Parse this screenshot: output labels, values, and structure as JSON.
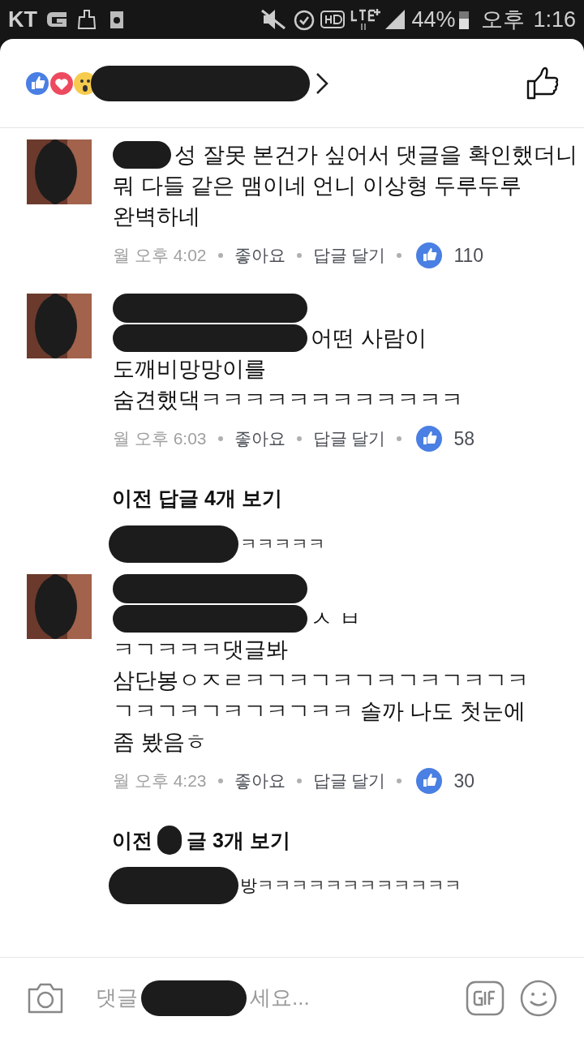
{
  "status_bar": {
    "carrier": "KT",
    "battery": "44%",
    "period": "오후",
    "time": "1:16"
  },
  "feed": [
    {
      "kind": "comment",
      "name_redacted": false,
      "lines": [
        {
          "text": "성 잘못 본건가 싶어서 댓글을 확인했더니",
          "redacted": true
        },
        {
          "text": "뭐 다들 같은 맴이네 언니 이상형 두루두루",
          "redacted": false
        },
        {
          "text": "완벽하네",
          "redacted": false
        }
      ],
      "time": "월 오후 4:02",
      "like_label": "좋아요",
      "reply_label": "답글 달기",
      "like_count": "110"
    },
    {
      "kind": "comment",
      "name_redacted": true,
      "lines": [
        {
          "text": "어떤 사람이",
          "redacted": true
        },
        {
          "text": "도깨비망망이를",
          "redacted": false
        },
        {
          "text": "숨견했댁ㅋㅋㅋㅋㅋㅋㅋㅋㅋㅋㅋㅋ",
          "redacted": false
        }
      ],
      "time": "월 오후 6:03",
      "like_label": "좋아요",
      "reply_label": "답글 달기",
      "like_count": "58"
    },
    {
      "kind": "more",
      "label": "이전 답글 4개 보기",
      "redacted_part": false
    },
    {
      "kind": "reply",
      "text": "ㅋㅋㅋㅋㅋ"
    },
    {
      "kind": "comment",
      "name_redacted": true,
      "lines": [
        {
          "text": "ㅅ ㅂ",
          "redacted": true
        },
        {
          "text": "ㅋㄱㅋㅋㅋ댓글봐",
          "redacted": false
        },
        {
          "text": "삼단봉ㅇㅈㄹㅋㄱㅋㄱㅋㄱㅋㄱㅋㄱㅋㄱㅋ",
          "redacted": false
        },
        {
          "text": "ㄱㅋㄱㅋㄱㅋㄱㅋㄱㅋㅋ 솔까 나도 첫눈에",
          "redacted": false
        },
        {
          "text": "좀 봤음ㅎ",
          "redacted": false
        }
      ],
      "time": "월 오후 4:23",
      "like_label": "좋아요",
      "reply_label": "답글 달기",
      "like_count": "30"
    },
    {
      "kind": "more",
      "label": "이전",
      "label_end": "글 3개 보기",
      "redacted_part": true
    },
    {
      "kind": "reply",
      "text": "방ㅋㅋㅋㅋㅋㅋㅋㅋㅋㅋㅋㅋ"
    }
  ],
  "composer": {
    "placeholder_start": "댓글",
    "placeholder_end": "세요..."
  }
}
